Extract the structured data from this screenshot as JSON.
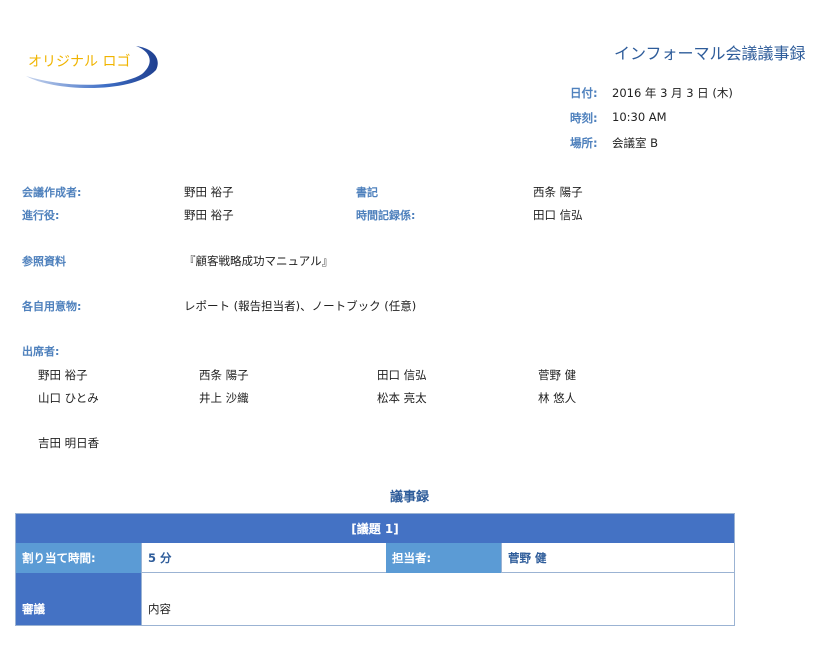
{
  "logo": {
    "text": "オリジナル ロゴ"
  },
  "title": "インフォーマル会議議事録",
  "meta": {
    "date_label": "日付:",
    "date_value": "2016 年 3 月 3 日 (木)",
    "time_label": "時刻:",
    "time_value": "10:30 AM",
    "place_label": "場所:",
    "place_value": "会議室 B"
  },
  "roles": {
    "creator_label": "会議作成者:",
    "creator_value": "野田 裕子",
    "secretary_label": "書記",
    "secretary_value": "西条 陽子",
    "facilitator_label": "進行役:",
    "facilitator_value": "野田 裕子",
    "timekeeper_label": "時間記録係:",
    "timekeeper_value": "田口 信弘"
  },
  "reference": {
    "label": "参照資料",
    "value": "『顧客戦略成功マニュアル』"
  },
  "bring": {
    "label": "各自用意物:",
    "value": "レポート (報告担当者)、ノートブック (任意)"
  },
  "attendees": {
    "label": "出席者:",
    "names": [
      "野田 裕子",
      "西条 陽子",
      "田口 信弘",
      "菅野 健",
      "山口 ひとみ",
      "井上 沙織",
      "松本 亮太",
      "林 悠人",
      "吉田 明日香"
    ]
  },
  "minutes": {
    "heading": "議事録",
    "agenda_title": "[議題 1]",
    "allotted_label": "割り当て時間:",
    "allotted_value": "5 分",
    "presenter_label": "担当者:",
    "presenter_value": "菅野 健",
    "discussion_label": "審議",
    "discussion_value": "内容"
  }
}
